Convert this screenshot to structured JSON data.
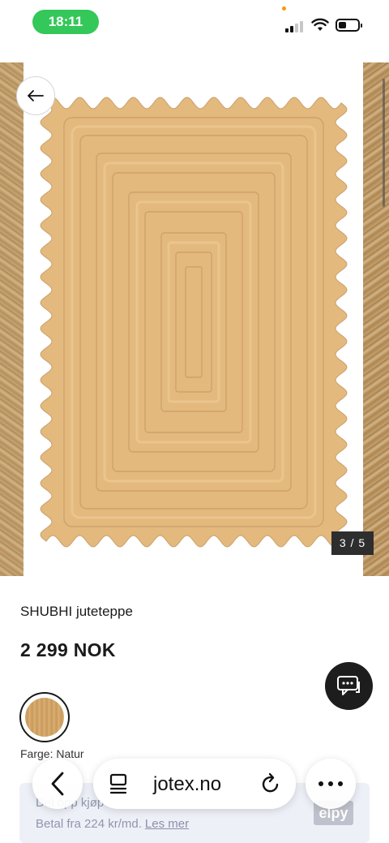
{
  "status_bar": {
    "time": "18:11"
  },
  "gallery": {
    "counter": "3 / 5",
    "image_alt": "SHUBHI juteteppe"
  },
  "product": {
    "title": "SHUBHI juteteppe",
    "price": "2 299 NOK",
    "color_label": "Farge: Natur"
  },
  "payment": {
    "line1": "Del opp kjøp",
    "line2": "Betal fra 224 kr/md.",
    "link": "Les mer",
    "brand": "elpy"
  },
  "browser": {
    "url": "jotex.no"
  },
  "icons": [
    "back-arrow-icon",
    "chat-icon",
    "chevron-left-icon",
    "page-menu-icon",
    "reload-icon",
    "more-icon",
    "wifi-icon",
    "signal-icon",
    "battery-icon"
  ],
  "colors": {
    "status_pill": "#34c759",
    "jute": "#e2b97e",
    "chat_button": "#1d1d1d",
    "pay_box": "#eef0f8"
  }
}
